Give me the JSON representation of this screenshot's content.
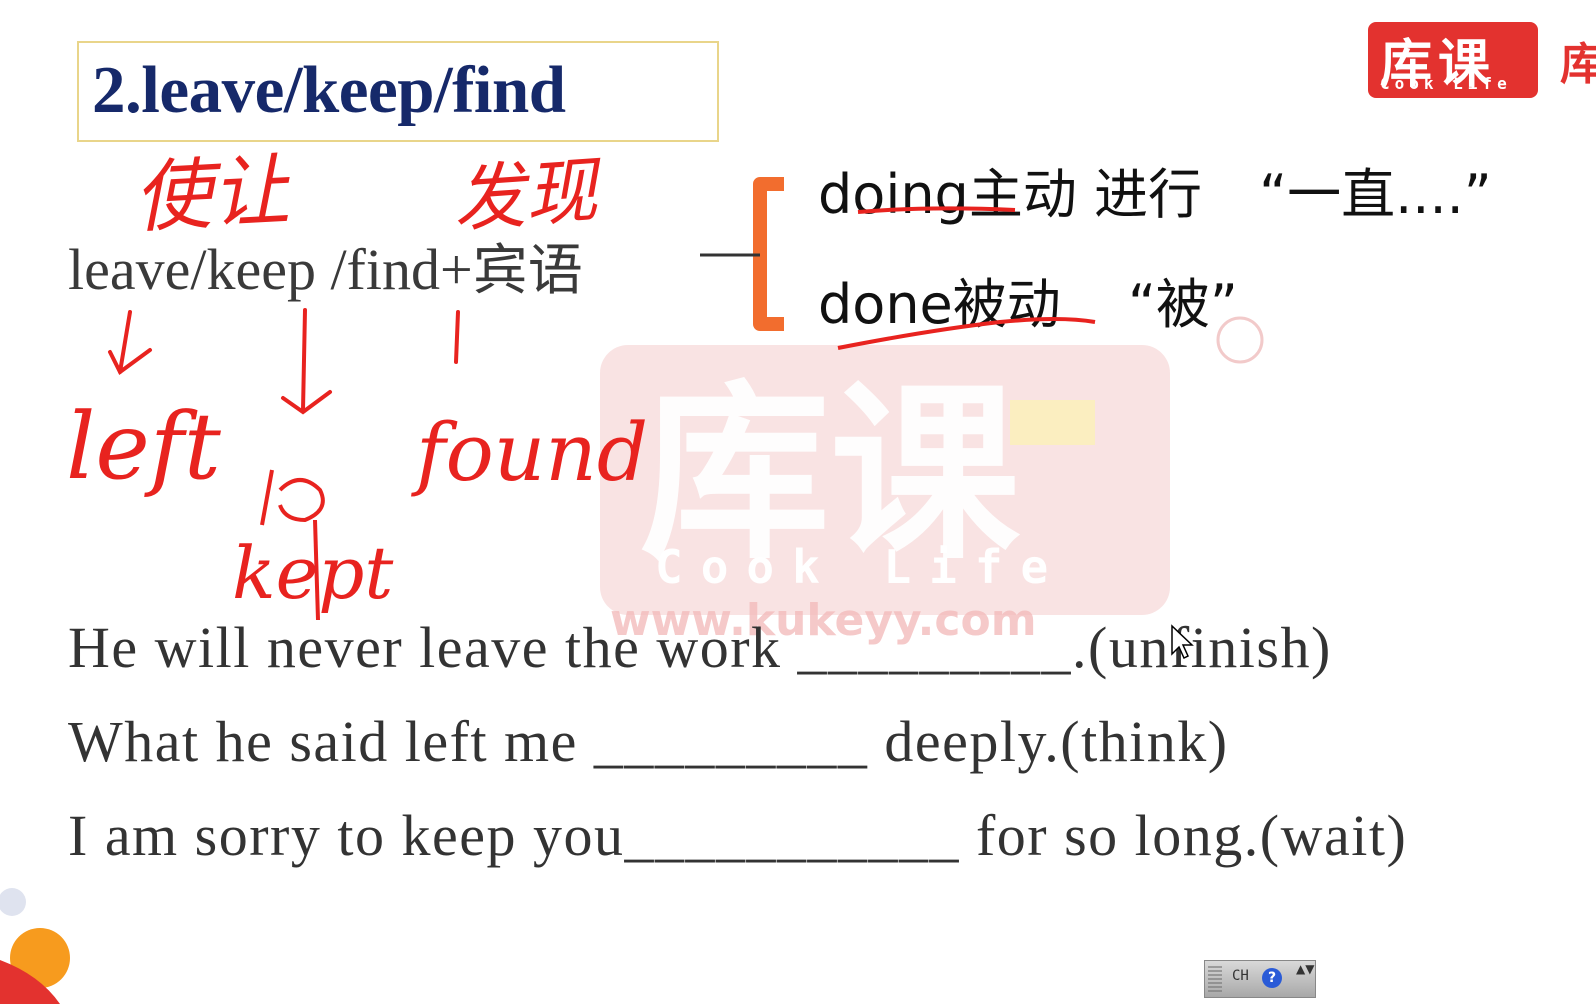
{
  "slide": {
    "title": "2.leave/keep/find",
    "formula": {
      "verbs": "leave/keep /find+",
      "object": "宾语"
    },
    "options": [
      {
        "form": "doing",
        "voice": "主动 进行",
        "meaning": "“一直....”"
      },
      {
        "form": "done",
        "voice": "被动",
        "meaning": "“被”"
      }
    ],
    "annotations": {
      "over_leave_keep": "使让",
      "over_find": "发现",
      "leave_past": "left",
      "keep_past": "kept",
      "find_past": "found"
    },
    "sentences": [
      "He will never leave the work _________.(unfinish)",
      "What he said left me _________  deeply.(think)",
      "I am sorry to keep you___________ for so long.(wait)"
    ]
  },
  "logo": {
    "name": "库课",
    "tagline": "Cook Life",
    "edge_text": "库"
  },
  "watermark": {
    "name": "库课",
    "tagline": "Cook Life",
    "url": "www.kukeyy.com"
  },
  "ime": {
    "label": "CH",
    "help": "?",
    "arrows": "▲▼"
  },
  "colors": {
    "title": "#16296a",
    "ink": "#e8231f",
    "brace": "#f26d2e",
    "logo": "#e3322f"
  }
}
